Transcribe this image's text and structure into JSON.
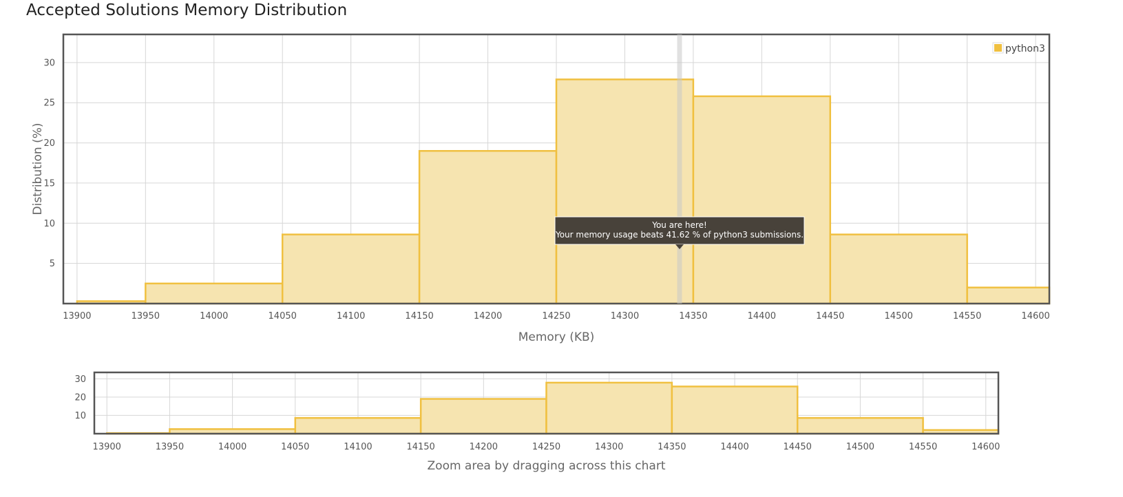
{
  "title": "Accepted Solutions Memory Distribution",
  "chart_data": [
    {
      "type": "bar",
      "categories": [
        "13900",
        "13950",
        "14050",
        "14150",
        "14250",
        "14350",
        "14450",
        "14550"
      ],
      "bins": [
        [
          13900,
          13950
        ],
        [
          13950,
          14050
        ],
        [
          14050,
          14150
        ],
        [
          14150,
          14250
        ],
        [
          14250,
          14350
        ],
        [
          14350,
          14450
        ],
        [
          14450,
          14550
        ],
        [
          14550,
          14610
        ]
      ],
      "series": [
        {
          "name": "python3",
          "values": [
            0.3,
            2.5,
            8.6,
            19.0,
            27.9,
            25.8,
            8.6,
            2.0
          ]
        }
      ],
      "xlabel": "Memory (KB)",
      "ylabel": "Distribution (%)",
      "xlim": [
        13890,
        14610
      ],
      "ylim": [
        0,
        33.5
      ],
      "xticks": [
        13900,
        13950,
        14000,
        14050,
        14100,
        14150,
        14200,
        14250,
        14300,
        14350,
        14400,
        14450,
        14500,
        14550,
        14600
      ],
      "yticks": [
        5,
        10,
        15,
        20,
        25,
        30
      ],
      "grid": true,
      "legend": {
        "position": "top-right",
        "label": "python3"
      },
      "marker": {
        "x": 14340
      },
      "tooltip": {
        "line1": "You are here!",
        "line2": "Your memory usage beats 41.62 % of python3 submissions."
      },
      "color": "#f0c040",
      "fill_color": "#f6e4b0"
    },
    {
      "type": "bar",
      "categories": [
        "13900",
        "13950",
        "14050",
        "14150",
        "14250",
        "14350",
        "14450",
        "14550"
      ],
      "bins": [
        [
          13900,
          13950
        ],
        [
          13950,
          14050
        ],
        [
          14050,
          14150
        ],
        [
          14150,
          14250
        ],
        [
          14250,
          14350
        ],
        [
          14350,
          14450
        ],
        [
          14450,
          14550
        ],
        [
          14550,
          14610
        ]
      ],
      "series": [
        {
          "name": "python3",
          "values": [
            0.3,
            2.5,
            8.6,
            19.0,
            27.9,
            25.8,
            8.6,
            2.0
          ]
        }
      ],
      "xlabel": "Zoom area by dragging across this chart",
      "xlim": [
        13890,
        14610
      ],
      "ylim": [
        0,
        33.5
      ],
      "xticks": [
        13900,
        13950,
        14000,
        14050,
        14100,
        14150,
        14200,
        14250,
        14300,
        14350,
        14400,
        14450,
        14500,
        14550,
        14600
      ],
      "yticks": [
        10,
        20,
        30
      ],
      "grid": true,
      "color": "#f0c040",
      "fill_color": "#f6e4b0"
    }
  ]
}
